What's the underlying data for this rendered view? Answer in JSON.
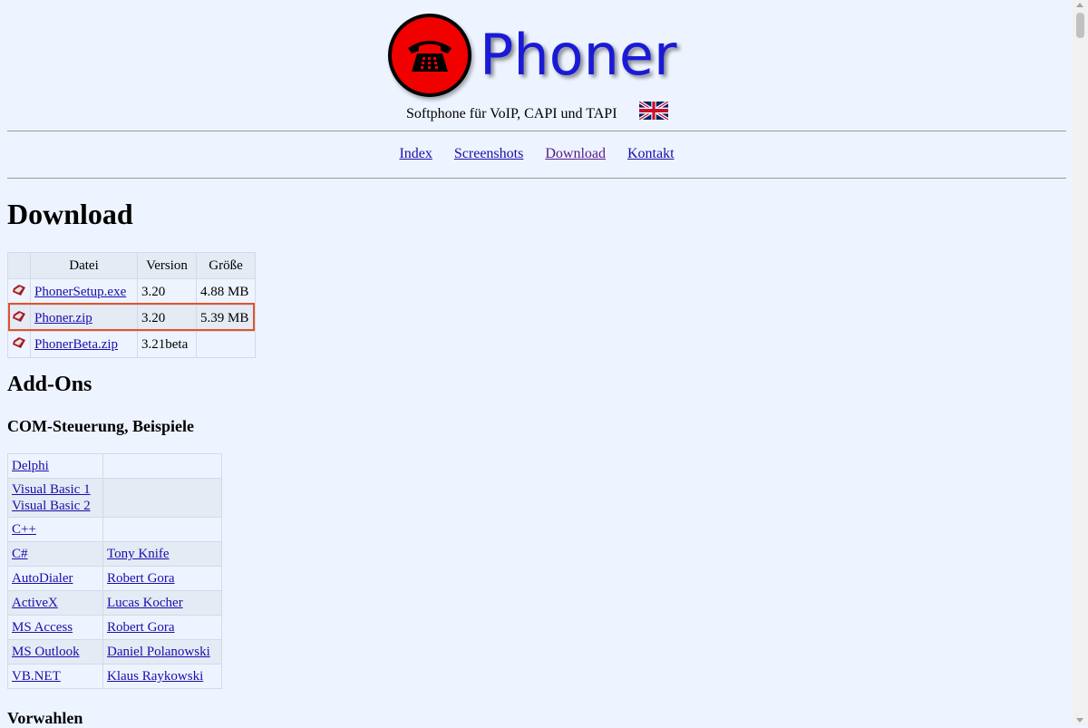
{
  "header": {
    "logo_text": "Phoner",
    "subtitle": "Softphone für VoIP, CAPI und TAPI",
    "flag": "uk-flag-icon"
  },
  "nav": {
    "items": [
      "Index",
      "Screenshots",
      "Download",
      "Kontakt"
    ]
  },
  "page_title": "Download",
  "download_table": {
    "headers": [
      "Datei",
      "Version",
      "Größe"
    ],
    "rows": [
      {
        "file": "PhonerSetup.exe",
        "version": "3.20",
        "size": "4.88 MB"
      },
      {
        "file": "Phoner.zip",
        "version": "3.20",
        "size": "5.39 MB"
      },
      {
        "file": "PhonerBeta.zip",
        "version": "3.21beta",
        "size": ""
      }
    ]
  },
  "addons": {
    "title": "Add-Ons",
    "com_title": "COM-Steuerung, Beispiele",
    "rows": [
      {
        "lang": "Delphi",
        "author": ""
      },
      {
        "lang": "Visual Basic 1",
        "lang2": "Visual Basic 2",
        "author": ""
      },
      {
        "lang": "C++",
        "author": ""
      },
      {
        "lang": "C#",
        "author": "Tony Knife"
      },
      {
        "lang": "AutoDialer",
        "author": "Robert Gora"
      },
      {
        "lang": "ActiveX",
        "author": "Lucas Kocher"
      },
      {
        "lang": "MS Access",
        "author": "Robert Gora"
      },
      {
        "lang": "MS Outlook",
        "author": "Daniel Polanowski"
      },
      {
        "lang": "VB.NET",
        "author": "Klaus Raykowski"
      }
    ]
  },
  "vorwahlen_title": "Vorwahlen",
  "colors": {
    "background": "#eef4ff",
    "logo_red": "#f10000",
    "logo_text": "#1a1ad6",
    "link": "#1a0dab",
    "visited_link": "#551a8b",
    "highlight_border": "#e0542a"
  }
}
